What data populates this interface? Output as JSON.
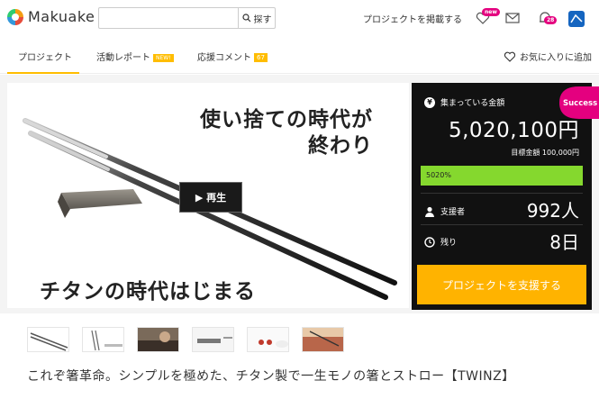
{
  "header": {
    "logo_text": "Makuake",
    "search_placeholder": "",
    "search_button": "探す",
    "post_project": "プロジェクトを掲載する",
    "new_badge": "new",
    "notify_count": "28"
  },
  "tabs": {
    "project": "プロジェクト",
    "activity": "活動レポート",
    "activity_tag": "NEW!",
    "comments": "応援コメント",
    "comments_count": "67",
    "favorite": "お気に入りに追加"
  },
  "hero": {
    "headline_1": "使い捨ての時代が",
    "headline_2": "終わり",
    "headline_bottom": "チタンの時代はじまる",
    "play_label": "▶ 再生"
  },
  "panel": {
    "ribbon": "Success",
    "amount_label": "集まっている金額",
    "amount": "5,020,100円",
    "goal": "目標金額 100,000円",
    "progress_text": "5020%",
    "progress_fraction": 1.0,
    "supporters_label": "支援者",
    "supporters_value": "992人",
    "remaining_label": "残り",
    "remaining_value": "8日",
    "cta": "プロジェクトを支援する"
  },
  "project_title": "これぞ箸革命。シンプルを極めた、チタン製で一生モノの箸とストロー【TWINZ】",
  "colors": {
    "accent": "#ffbd00",
    "progress": "#85d82e",
    "ribbon": "#e4007f",
    "panel_bg": "#111111"
  }
}
